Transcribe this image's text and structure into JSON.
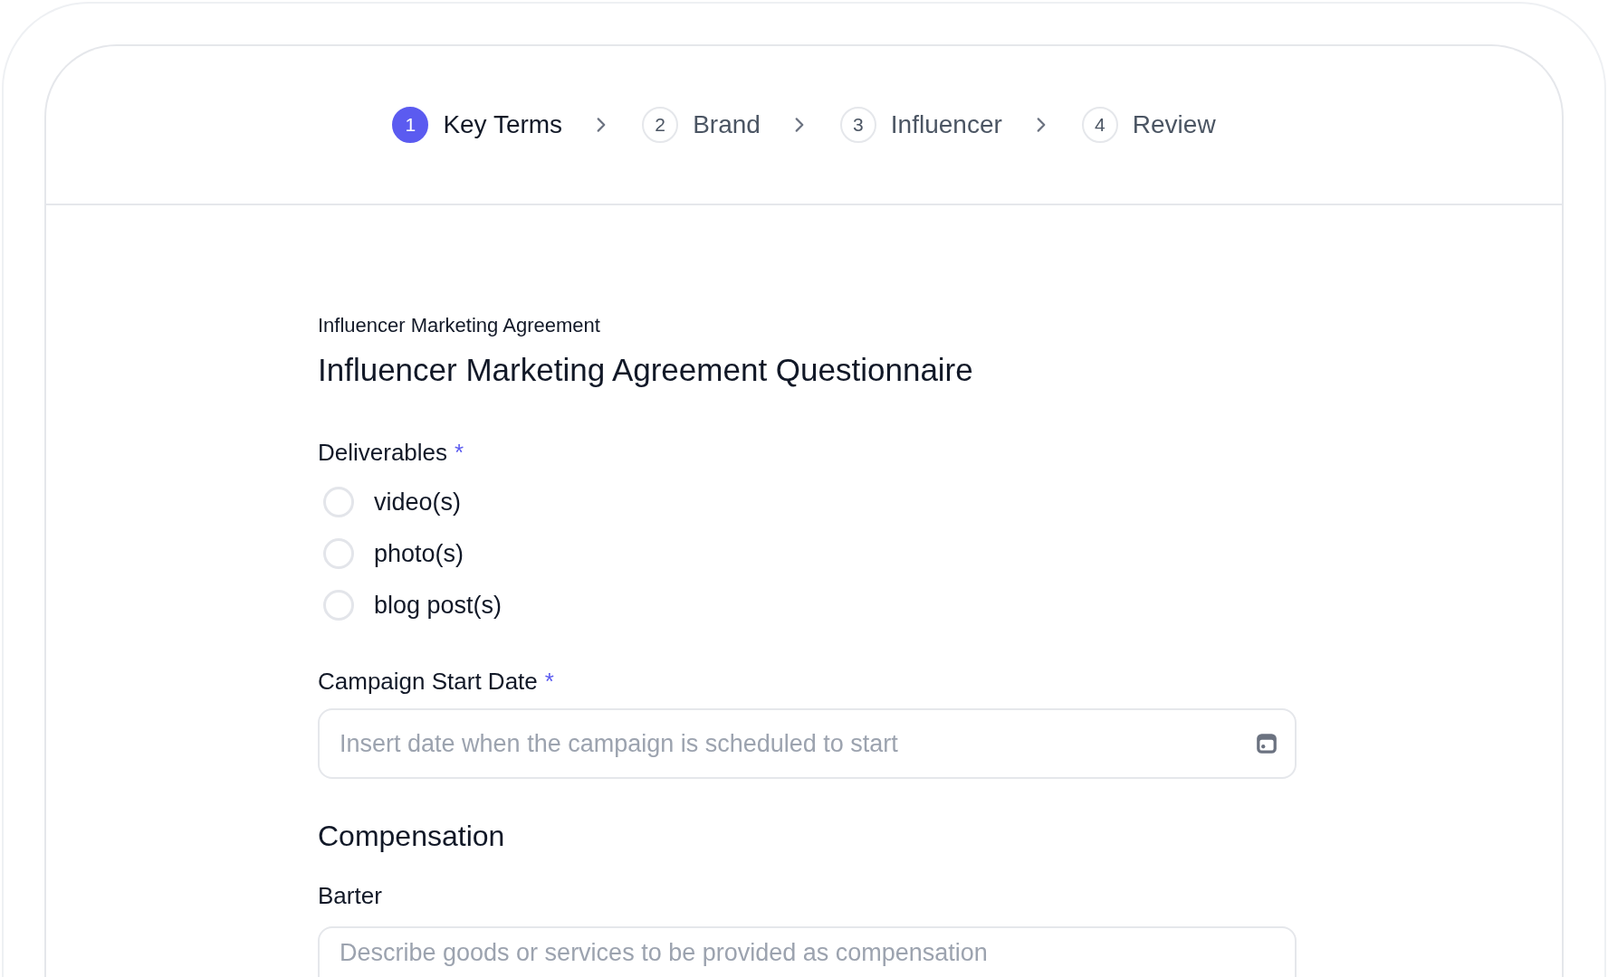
{
  "steps": [
    {
      "number": "1",
      "label": "Key Terms",
      "selected": true
    },
    {
      "number": "2",
      "label": "Brand",
      "selected": false
    },
    {
      "number": "3",
      "label": "Influencer",
      "selected": false
    },
    {
      "number": "4",
      "label": "Review",
      "selected": false
    }
  ],
  "form": {
    "eyebrow": "Influencer Marketing Agreement",
    "title": "Influencer Marketing Agreement Questionnaire",
    "deliverables": {
      "label": "Deliverables",
      "required_mark": "*",
      "options": [
        {
          "label": "video(s)",
          "selected": false
        },
        {
          "label": "photo(s)",
          "selected": false
        },
        {
          "label": "blog post(s)",
          "selected": false
        }
      ]
    },
    "start_date": {
      "label": "Campaign Start Date",
      "required_mark": "*",
      "placeholder": "Insert date when the campaign is scheduled to start"
    },
    "section": "Compensation",
    "barter": {
      "label": "Barter",
      "placeholder": "Describe goods or services to be provided as compensation"
    }
  }
}
